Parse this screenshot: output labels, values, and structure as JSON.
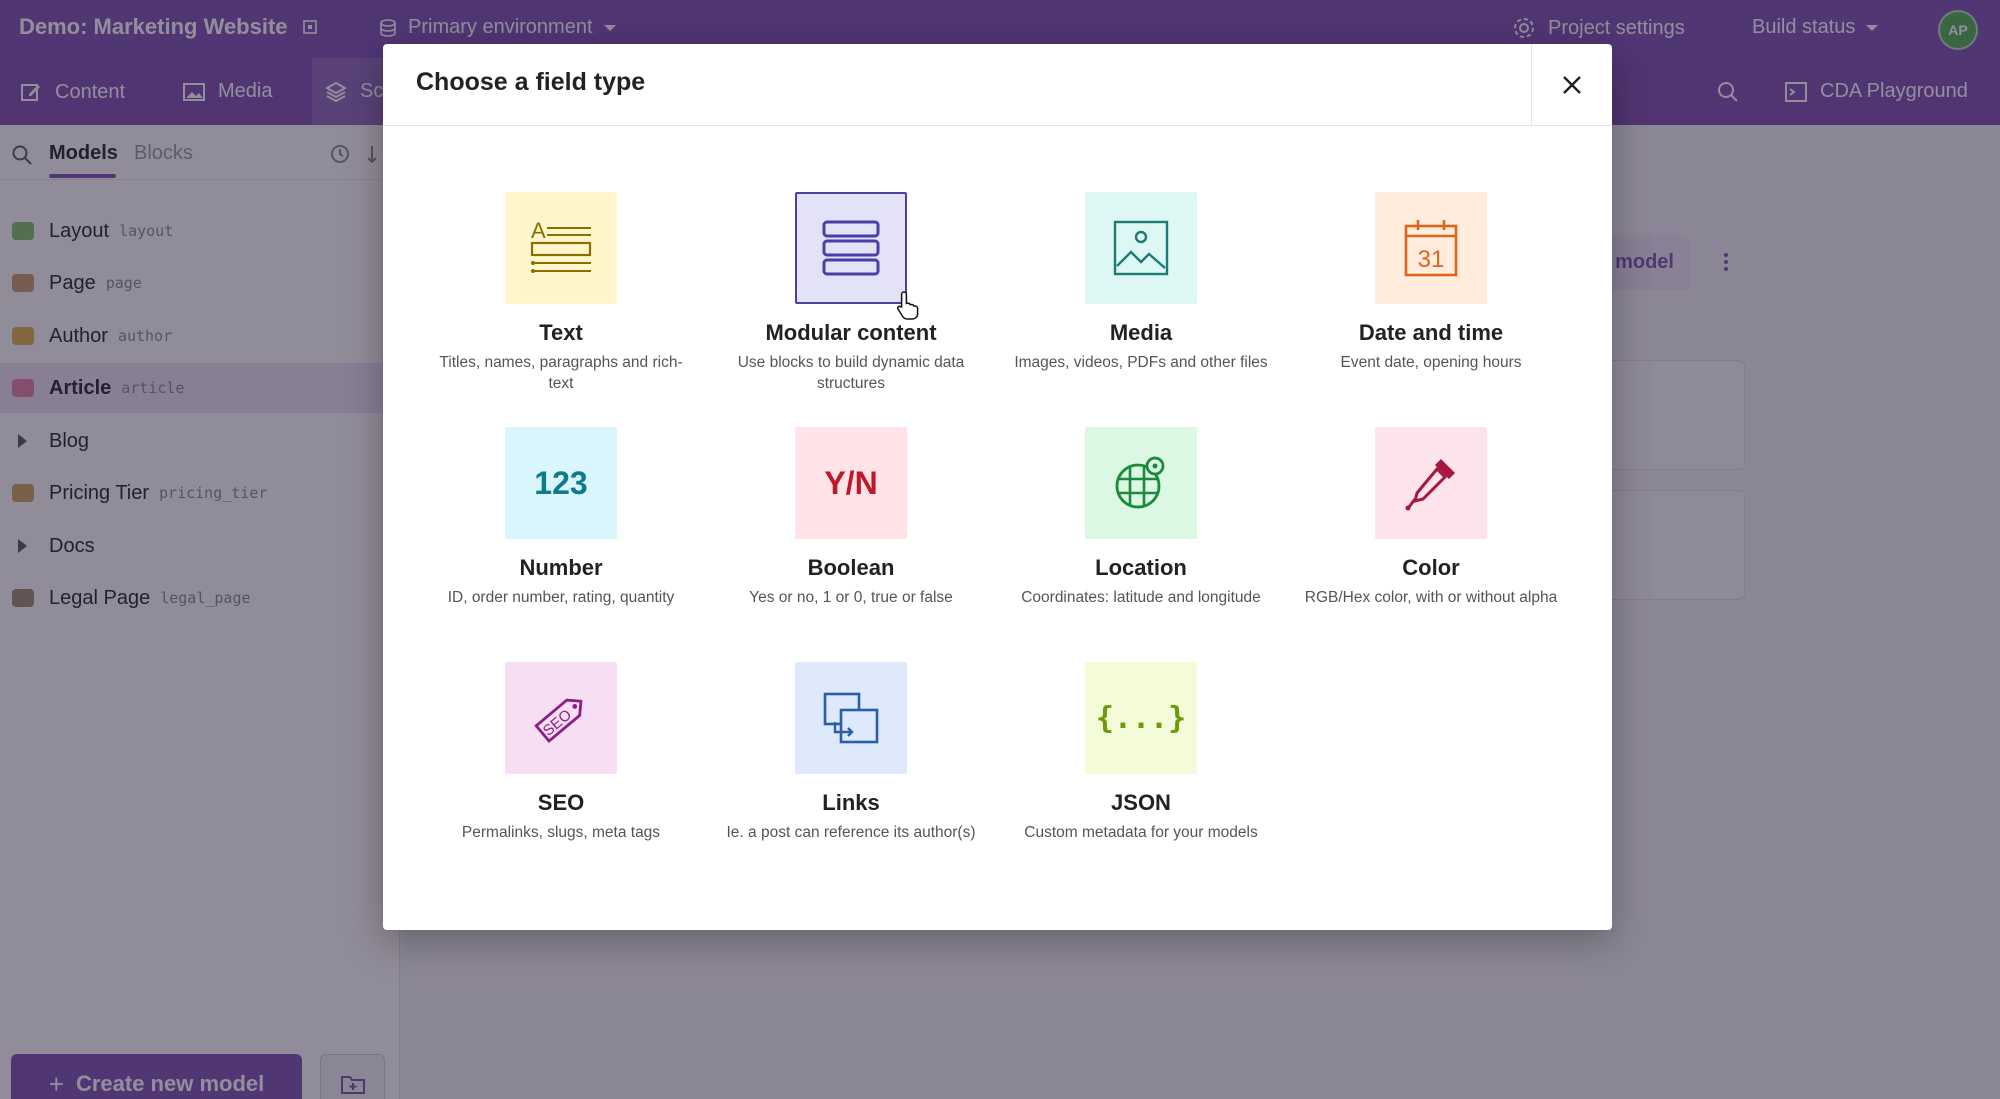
{
  "app": {
    "project_title": "Demo: Marketing Website",
    "environment": "Primary environment",
    "project_settings": "Project settings",
    "build_status": "Build status",
    "avatar_initials": "AP"
  },
  "nav": {
    "content": "Content",
    "media": "Media",
    "schema": "Sc",
    "cda_playground": "CDA Playground"
  },
  "sidebar": {
    "tabs": [
      "Models",
      "Blocks"
    ],
    "items": [
      {
        "label": "Layout",
        "api": "layout",
        "color": "#7fbf6a"
      },
      {
        "label": "Page",
        "api": "page",
        "color": "#c49b6a"
      },
      {
        "label": "Author",
        "api": "author",
        "color": "#e0b04c"
      },
      {
        "label": "Article",
        "api": "article",
        "color": "#e07fa0"
      },
      {
        "label": "Blog",
        "api": ""
      },
      {
        "label": "Pricing Tier",
        "api": "pricing_tier",
        "color": "#c9a55a"
      },
      {
        "label": "Docs",
        "api": ""
      },
      {
        "label": "Legal Page",
        "api": "legal_page",
        "color": "#9a8b72"
      }
    ],
    "create_button": "Create new model"
  },
  "background": {
    "model_button": "model"
  },
  "modal": {
    "title": "Choose a field type",
    "fields": [
      {
        "name": "Text",
        "desc": "Titles, names, paragraphs and rich-text",
        "bg": "#fff6cc",
        "icon": "text-icon"
      },
      {
        "name": "Modular content",
        "desc": "Use blocks to build dynamic data structures",
        "bg": "#e4e2f7",
        "icon": "modular-content-icon"
      },
      {
        "name": "Media",
        "desc": "Images, videos, PDFs and other files",
        "bg": "#dcf7f4",
        "icon": "image-icon"
      },
      {
        "name": "Date and time",
        "desc": "Event date, opening hours",
        "bg": "#ffecdd",
        "icon": "calendar-icon",
        "calendar_day": "31"
      },
      {
        "name": "Number",
        "desc": "ID, order number, rating, quantity",
        "bg": "#d8f6fb",
        "icon": "number-icon",
        "glyph": "123"
      },
      {
        "name": "Boolean",
        "desc": "Yes or no, 1 or 0, true or false",
        "bg": "#ffe3e6",
        "icon": "boolean-icon",
        "glyph": "Y/N"
      },
      {
        "name": "Location",
        "desc": "Coordinates: latitude and longitude",
        "bg": "#dcf8e2",
        "icon": "location-icon"
      },
      {
        "name": "Color",
        "desc": "RGB/Hex color, with or without alpha",
        "bg": "#fce3ec",
        "icon": "color-picker-icon"
      },
      {
        "name": "SEO",
        "desc": "Permalinks, slugs, meta tags",
        "bg": "#f6dff4",
        "icon": "seo-tag-icon",
        "glyph": "SEO"
      },
      {
        "name": "Links",
        "desc": "Ie. a post can reference its author(s)",
        "bg": "#dee9fb",
        "icon": "links-icon"
      },
      {
        "name": "JSON",
        "desc": "Custom metadata for your models",
        "bg": "#f3fbd9",
        "icon": "json-icon",
        "glyph": "{...}"
      }
    ]
  }
}
